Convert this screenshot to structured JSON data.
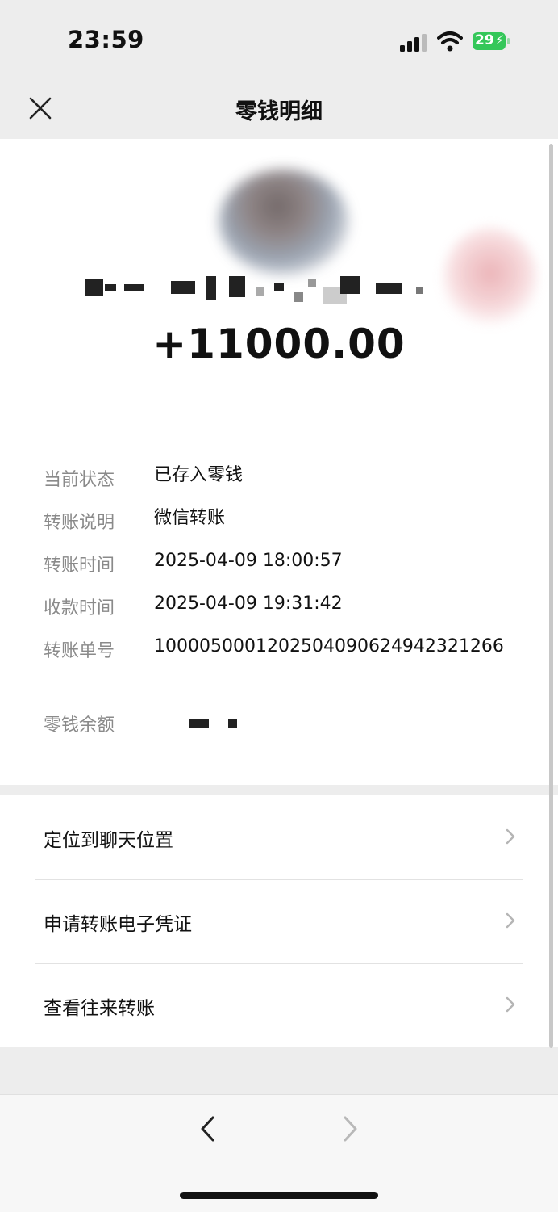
{
  "status_bar": {
    "time": "23:59",
    "battery_level": "29",
    "signal_icon": "cellular-signal-icon",
    "wifi_icon": "wifi-icon",
    "battery_icon": "battery-charging-icon"
  },
  "nav": {
    "title": "零钱明细",
    "close_icon": "close-icon"
  },
  "detail": {
    "amount": "+11000.00",
    "rows": [
      {
        "label": "当前状态",
        "value": "已存入零钱"
      },
      {
        "label": "转账说明",
        "value": "微信转账"
      },
      {
        "label": "转账时间",
        "value": "2025-04-09 18:00:57"
      },
      {
        "label": "收款时间",
        "value": "2025-04-09 19:31:42"
      },
      {
        "label": "转账单号",
        "value": "1000050001202504090624942321266"
      },
      {
        "label": "零钱余额",
        "value": ""
      }
    ]
  },
  "menu": [
    {
      "label": "定位到聊天位置"
    },
    {
      "label": "申请转账电子凭证"
    },
    {
      "label": "查看往来转账"
    }
  ],
  "bottom_bar": {
    "back_icon": "chevron-left-icon",
    "forward_icon": "chevron-right-icon"
  },
  "colors": {
    "background": "#ededed",
    "card": "#ffffff",
    "label_gray": "#8a8a8a",
    "battery_green": "#34c759"
  }
}
